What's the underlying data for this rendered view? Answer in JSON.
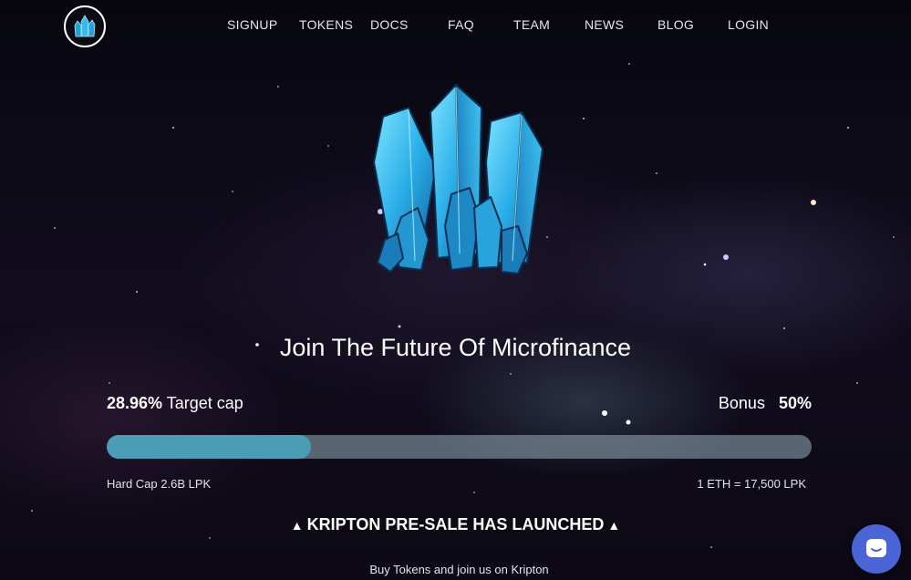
{
  "nav": {
    "items": [
      {
        "label": "SIGNUP"
      },
      {
        "label": "TOKENS"
      },
      {
        "label": "DOCS"
      },
      {
        "label": "FAQ"
      },
      {
        "label": "TEAM"
      },
      {
        "label": "NEWS"
      },
      {
        "label": "BLOG"
      },
      {
        "label": "LOGIN"
      }
    ]
  },
  "hero": {
    "headline": "Join The Future Of Microfinance",
    "progress_percent_label": "28.96%",
    "progress_text": "Target cap",
    "progress_value": 0.2896,
    "bonus_label": "Bonus",
    "bonus_value": "50%",
    "hard_cap": "Hard Cap 2.6B LPK",
    "exchange_rate": "1 ETH = 17,500 LPK",
    "presale_banner": "KRIPTON PRE-SALE HAS LAUNCHED",
    "tagline": "Buy Tokens and join us on Kripton"
  },
  "icons": {
    "logo": "crystal-logo-icon",
    "hero": "crystal-cluster-icon",
    "presale_left": "rocket-icon",
    "presale_right": "rocket-icon",
    "chat": "chat-bubble-icon"
  },
  "colors": {
    "progress_fill": "#4b9db6",
    "progress_track": "#8296a5",
    "chat_button": "#4b64d6",
    "crystal": "#2fb6f0"
  }
}
